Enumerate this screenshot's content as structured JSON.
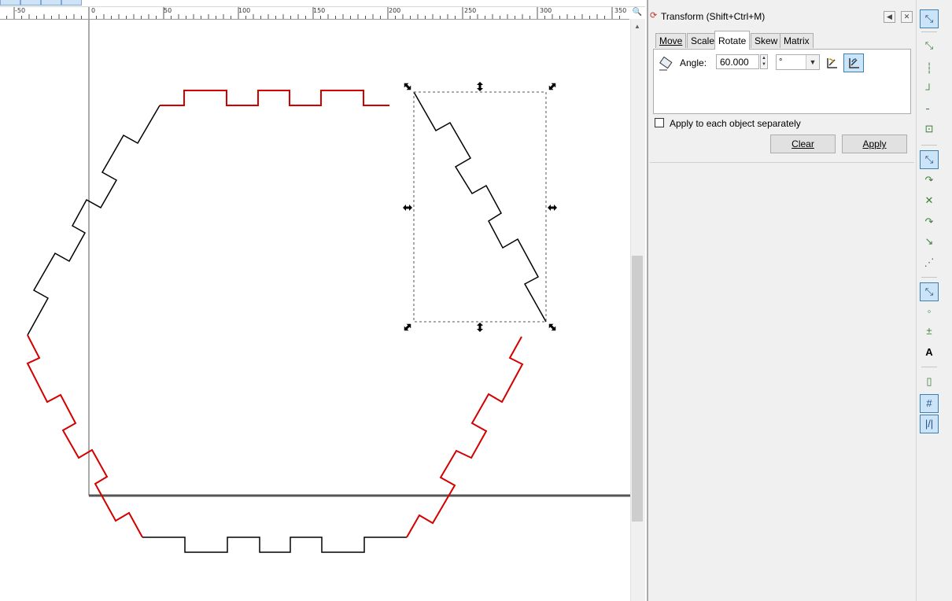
{
  "ruler": {
    "labels": [
      "-50",
      "0",
      "50",
      "100",
      "150",
      "200",
      "250",
      "300",
      "350"
    ]
  },
  "dialog": {
    "title": "Transform (Shift+Ctrl+M)",
    "tabs": [
      {
        "label": "Move"
      },
      {
        "label": "Scale"
      },
      {
        "label": "Rotate",
        "active": true
      },
      {
        "label": "Skew"
      },
      {
        "label": "Matrix"
      }
    ],
    "angle_label": "Angle:",
    "angle_value": "60.000",
    "unit_value": "°",
    "apply_each_label": "Apply to each object separately",
    "apply_each_checked": false,
    "clear_label": "Clear",
    "apply_label": "Apply"
  },
  "icons": {
    "dialog": "transform-dialog-icon",
    "rotate_ccw": "rotate-counterclockwise-icon",
    "rotate_cw": "rotate-clockwise-icon"
  },
  "snap_toolbar": [
    {
      "icon": "snap-enable-icon",
      "active": true
    },
    {
      "icon": "snap-bounding-box-icon",
      "active": false
    },
    {
      "icon": "snap-bbox-edges-icon",
      "active": false
    },
    {
      "icon": "snap-bbox-corners-icon",
      "active": false
    },
    {
      "icon": "snap-bbox-midpoints-icon",
      "active": false
    },
    {
      "icon": "snap-bbox-center-icon",
      "active": false
    },
    {
      "icon": "snap-nodes-icon",
      "active": true
    },
    {
      "icon": "snap-paths-icon",
      "active": false
    },
    {
      "icon": "snap-intersections-icon",
      "active": false
    },
    {
      "icon": "snap-cusp-nodes-icon",
      "active": false
    },
    {
      "icon": "snap-smooth-nodes-icon",
      "active": false
    },
    {
      "icon": "snap-line-midpoints-icon",
      "active": false
    },
    {
      "icon": "snap-others-icon",
      "active": true
    },
    {
      "icon": "snap-object-centers-icon",
      "active": false
    },
    {
      "icon": "snap-rotation-center-icon",
      "active": false
    },
    {
      "icon": "snap-text-baseline-icon",
      "active": false
    },
    {
      "icon": "snap-page-border-icon",
      "active": false
    },
    {
      "icon": "snap-grids-icon",
      "active": true
    },
    {
      "icon": "snap-guides-icon",
      "active": true
    }
  ],
  "colors": {
    "accent": "#cce4f7",
    "selected_path": "#000000",
    "other_path": "#d40000"
  }
}
